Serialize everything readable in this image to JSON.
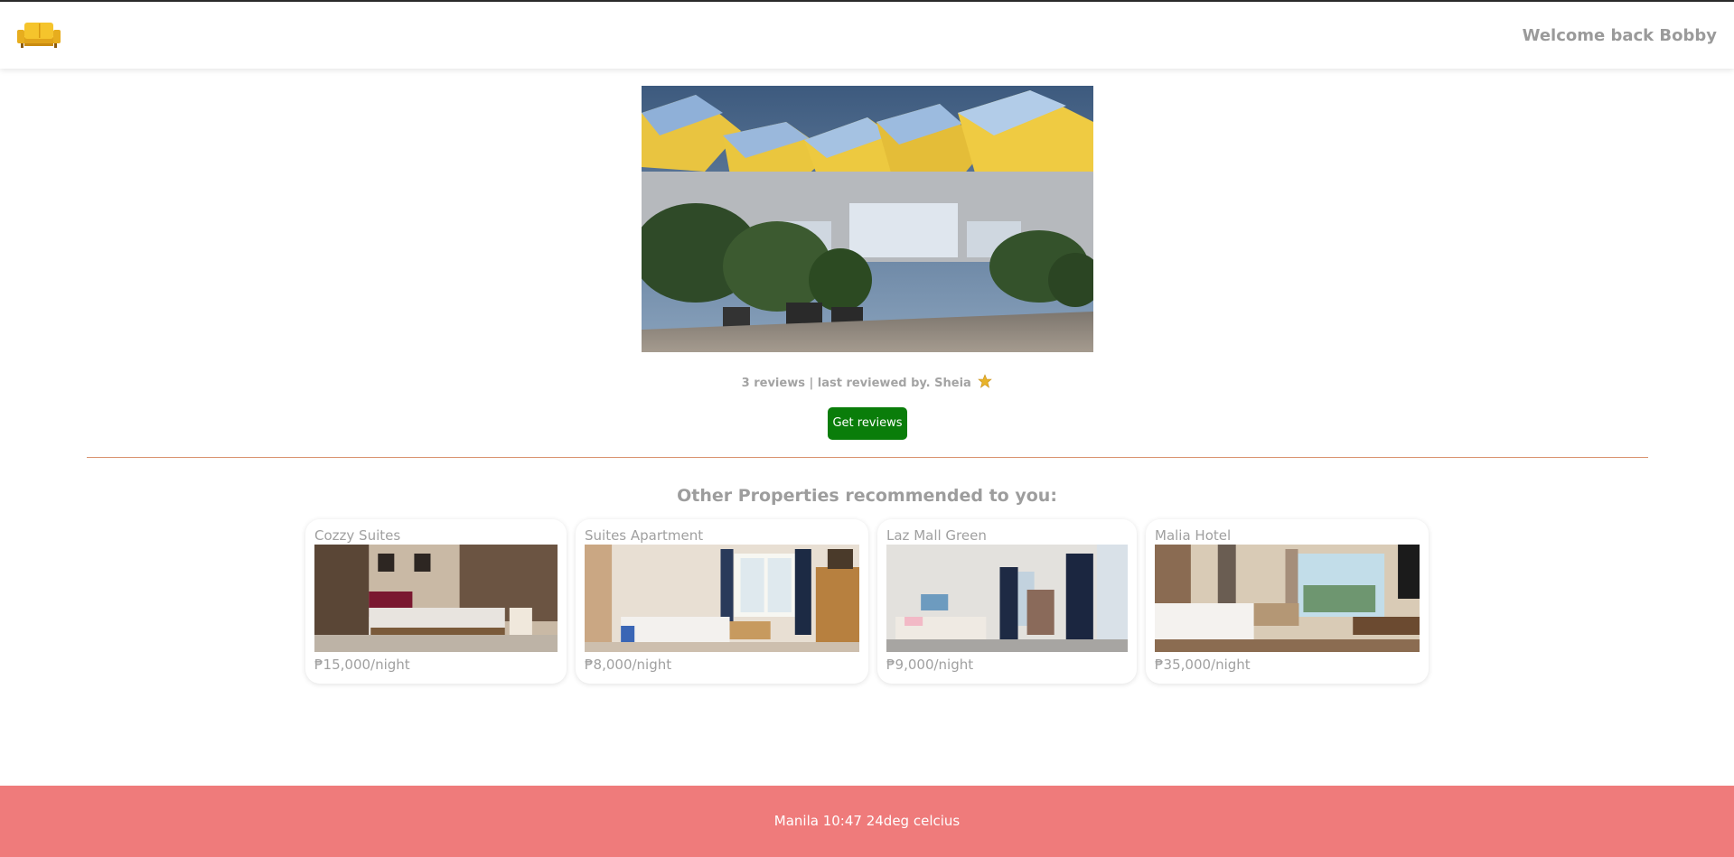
{
  "header": {
    "logo_icon": "sofa-icon",
    "welcome_text": "Welcome back Bobby"
  },
  "hero": {
    "image": "cube-houses-photo"
  },
  "reviews": {
    "summary_text": "3 reviews | last reviewed by. Sheia",
    "rating_icon": "star-icon",
    "button_label": "Get reviews"
  },
  "recommendations": {
    "title": "Other Properties recommended to you:",
    "cards": [
      {
        "name": "Cozzy Suites",
        "price": "₱15,000/night",
        "image": "bedroom-photo-1"
      },
      {
        "name": "Suites Apartment",
        "price": "₱8,000/night",
        "image": "bedroom-photo-2"
      },
      {
        "name": "Laz Mall Green",
        "price": "₱9,000/night",
        "image": "bedroom-photo-3"
      },
      {
        "name": "Malia Hotel",
        "price": "₱35,000/night",
        "image": "bedroom-photo-4"
      }
    ]
  },
  "footer": {
    "status_text": "Manila 10:47 24deg celcius"
  },
  "colors": {
    "accent_button": "#0a7d0a",
    "footer_bg": "#ef7b7b",
    "divider": "#d9926e"
  }
}
